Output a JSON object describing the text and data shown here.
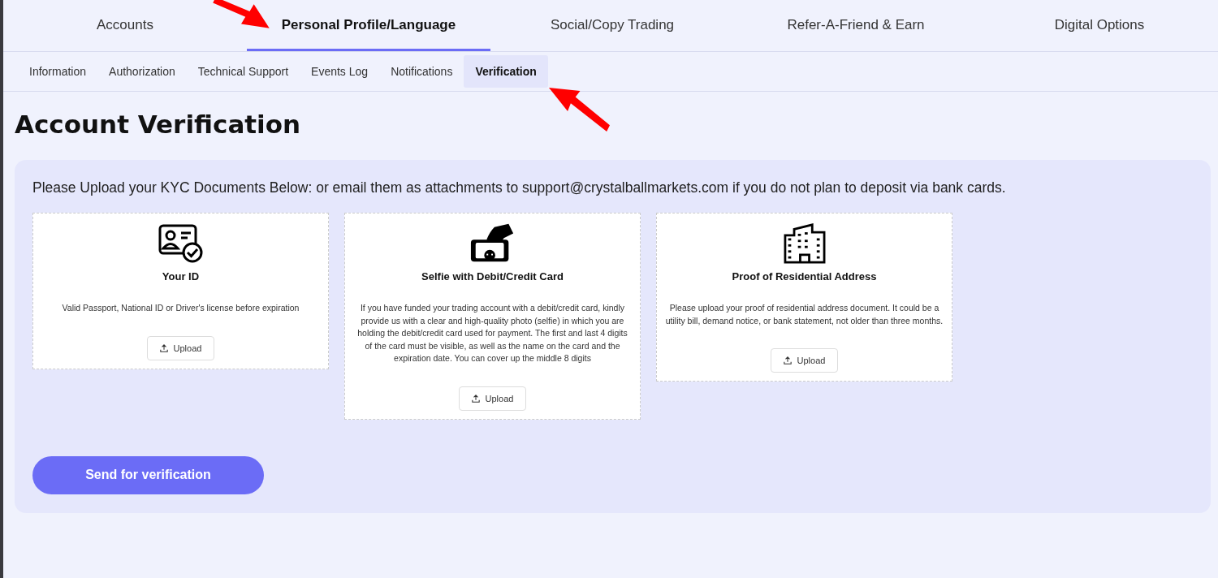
{
  "main_tabs": [
    {
      "label": "Accounts",
      "selected": false
    },
    {
      "label": "Personal Profile/Language",
      "selected": true
    },
    {
      "label": "Social/Copy Trading",
      "selected": false
    },
    {
      "label": "Refer-A-Friend & Earn",
      "selected": false
    },
    {
      "label": "Digital Options",
      "selected": false
    }
  ],
  "sub_tabs": [
    {
      "label": "Information",
      "selected": false
    },
    {
      "label": "Authorization",
      "selected": false
    },
    {
      "label": "Technical Support",
      "selected": false
    },
    {
      "label": "Events Log",
      "selected": false
    },
    {
      "label": "Notifications",
      "selected": false
    },
    {
      "label": "Verification",
      "selected": true
    }
  ],
  "page_title": "Account Verification",
  "intro": "Please Upload your KYC Documents Below: or email them as attachments to support@crystalballmarkets.com if you do not plan to deposit via bank cards.",
  "documents": [
    {
      "kind": "id",
      "title": "Your ID",
      "description": "Valid Passport, National ID or Driver's license before expiration",
      "button": "Upload"
    },
    {
      "kind": "selfie",
      "title": "Selfie with Debit/Credit Card",
      "description": "If you have funded your trading account with a debit/credit card, kindly provide us with a clear and high-quality photo (selfie) in which you are holding the debit/credit card used for payment. The first and last 4 digits of the card must be visible, as well as the name on the card and the expiration date. You can cover up the middle 8 digits",
      "button": "Upload"
    },
    {
      "kind": "address",
      "title": "Proof of Residential Address",
      "description": "Please upload your proof of residential address document. It could be a utility bill, demand notice, or bank statement, not older than three months.",
      "button": "Upload"
    }
  ],
  "submit_button": "Send for verification"
}
